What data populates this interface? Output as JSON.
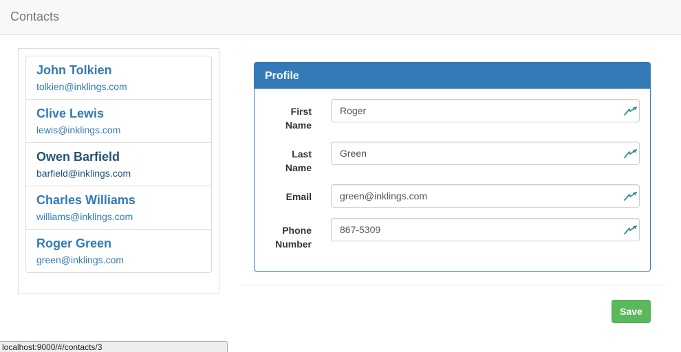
{
  "navbar": {
    "brand": "Contacts"
  },
  "contacts": [
    {
      "name": "John Tolkien",
      "email": "tolkien@inklings.com",
      "active": false
    },
    {
      "name": "Clive Lewis",
      "email": "lewis@inklings.com",
      "active": false
    },
    {
      "name": "Owen Barfield",
      "email": "barfield@inklings.com",
      "active": true
    },
    {
      "name": "Charles Williams",
      "email": "williams@inklings.com",
      "active": false
    },
    {
      "name": "Roger Green",
      "email": "green@inklings.com",
      "active": false
    }
  ],
  "profile": {
    "heading": "Profile",
    "fields": [
      {
        "label_line1": "First",
        "label_line2": "Name",
        "value": "Roger",
        "icon": "autofill-icon"
      },
      {
        "label_line1": "Last",
        "label_line2": "Name",
        "value": "Green",
        "icon": "autofill-icon"
      },
      {
        "label_line1": "Email",
        "label_line2": "",
        "value": "green@inklings.com",
        "icon": "autofill-icon"
      },
      {
        "label_line1": "Phone",
        "label_line2": "Number",
        "value": "867-5309",
        "icon": "autofill-icon"
      }
    ]
  },
  "actions": {
    "save_label": "Save"
  },
  "status_bar": {
    "url": "localhost:9000/#/contacts/3"
  },
  "colors": {
    "primary": "#337ab7",
    "success": "#5cb85c",
    "autofill_icon": "#3a8c8c"
  }
}
